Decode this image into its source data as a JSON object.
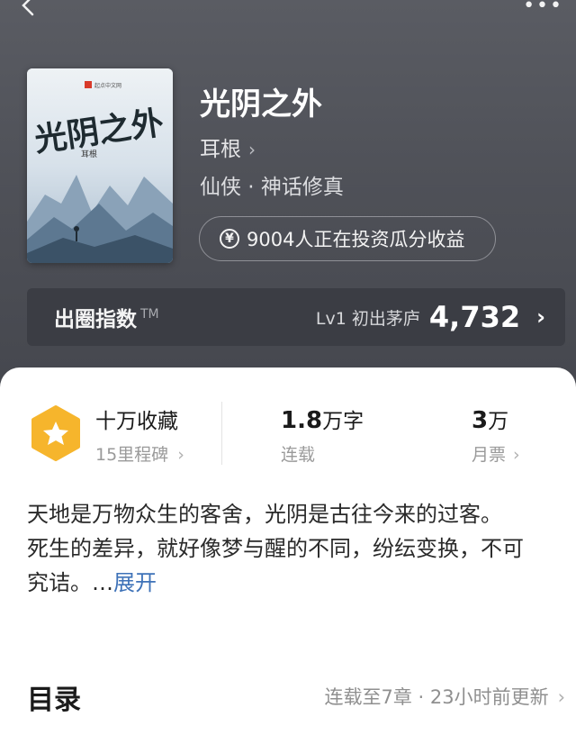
{
  "book": {
    "title": "光阴之外",
    "author": "耳根",
    "genre": "仙侠 · 神话修真",
    "cover": {
      "publisher_logo": "起点中文网",
      "title_art": "光阴之外",
      "author": "耳根"
    }
  },
  "invest": {
    "icon": "yen-icon",
    "label": "9004人正在投资瓜分收益"
  },
  "index_bar": {
    "name": "出圈指数",
    "tm": "TM",
    "level": "Lv1 初出茅庐",
    "value": "4,732"
  },
  "stats": {
    "collection": {
      "title": "十万收藏",
      "sub": "15里程碑"
    },
    "words": {
      "num": "1.8",
      "unit": "万字",
      "sub": "连载"
    },
    "tickets": {
      "num": "3",
      "unit": "万",
      "sub": "月票"
    }
  },
  "synopsis": {
    "line1": "天地是万物众生的客舍，光阴是古往今来的过客。",
    "line2": "死生的差异，就好像梦与醒的不同，纷纭变换，不可究诘。…",
    "more": "展开"
  },
  "toc": {
    "title": "目录",
    "status": "连载至7章 · 23小时前更新"
  },
  "colors": {
    "hero_bg": "#4f5158",
    "index_bar_bg": "#3b3d44",
    "badge": "#f6b52c",
    "link": "#3e72b8"
  }
}
